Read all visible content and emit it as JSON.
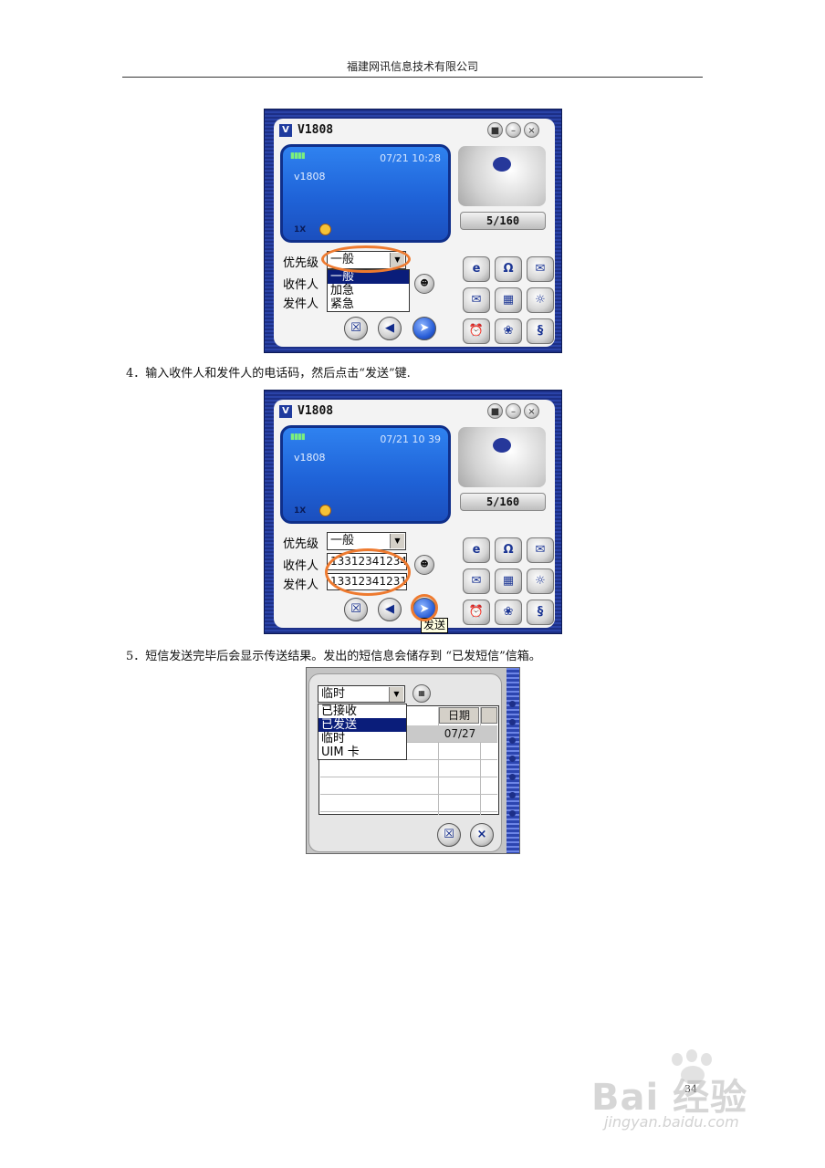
{
  "header": {
    "company": "福建网讯信息技术有限公司"
  },
  "steps": [
    {
      "number": "4",
      "text": "输入收件人和发件人的电话码，然后点击“发送”键."
    },
    {
      "number": "5",
      "text": "短信发送完毕后会显示传送结果。发出的短信息会储存到 “已发短信”信箱。"
    }
  ],
  "screenshot1": {
    "app_title": "V1808",
    "datetime": "07/21 10:28",
    "carrier": "v1808",
    "network": "1X",
    "counter": "5/160",
    "labels": {
      "priority": "优先级",
      "recipient": "收件人",
      "sender": "发件人"
    },
    "priority_value": "一般",
    "priority_options": [
      "一般",
      "加急",
      "紧急"
    ],
    "priority_selected_index": 0
  },
  "screenshot2": {
    "app_title": "V1808",
    "datetime": "07/21 10 39",
    "carrier": "v1808",
    "network": "1X",
    "counter": "5/160",
    "labels": {
      "priority": "优先级",
      "recipient": "收件人",
      "sender": "发件人"
    },
    "priority_value": "一般",
    "recipient_value": "13312341234",
    "sender_value": "13312341231",
    "tooltip": "发送"
  },
  "screenshot3": {
    "folder_value": "临时",
    "folder_options": [
      "已接收",
      "已发送",
      "临时",
      "UIM 卡"
    ],
    "folder_selected_index": 1,
    "column_date": "日期",
    "rows": [
      {
        "date": "07/27"
      }
    ]
  },
  "icons": {
    "close": "close-icon",
    "minimize": "minimize-icon",
    "lock": "lock-icon",
    "cancel": "cancel-icon",
    "back": "back-icon",
    "send": "send-icon"
  },
  "colors": {
    "accent_orange": "#ee7a2f",
    "frame_blue": "#1c2f86",
    "screen_blue": "#1f63d8",
    "selection": "#0a1d7a"
  },
  "page_number": "34",
  "watermark": {
    "brand": "Bai",
    "brand_suffix": "经验",
    "url": "jingyan.baidu.com"
  }
}
